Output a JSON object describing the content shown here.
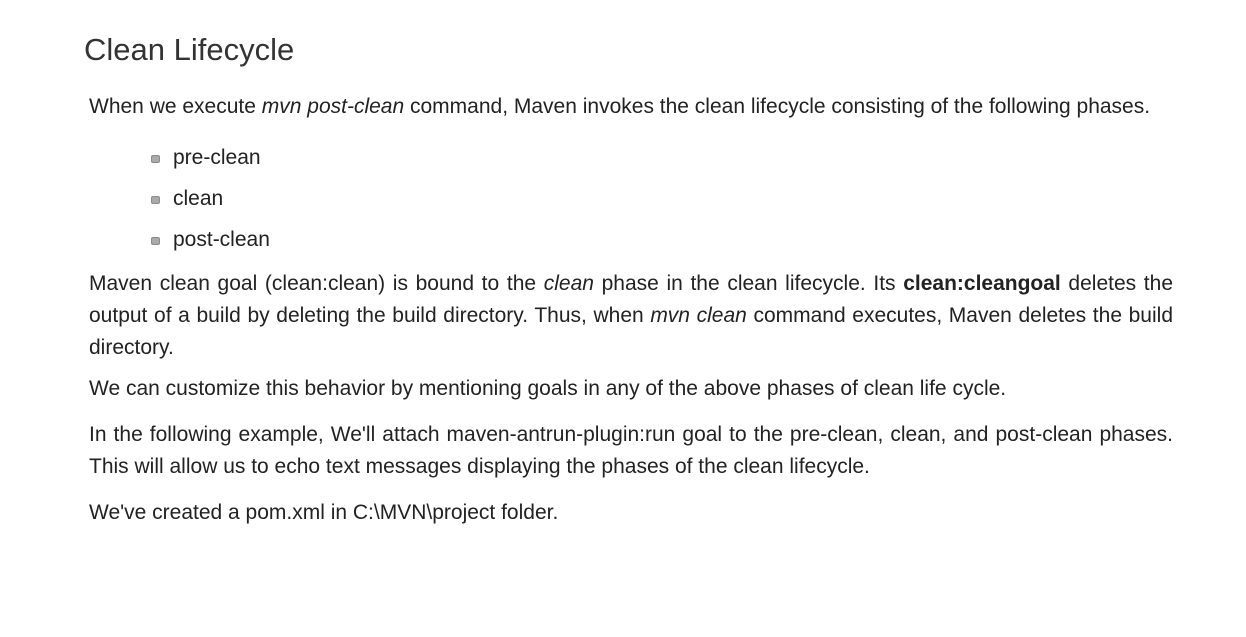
{
  "heading": "Clean Lifecycle",
  "intro": {
    "text_1": "When we execute ",
    "em_1": "mvn post-clean",
    "text_2": " command, Maven invokes the clean lifecycle consisting of the following phases."
  },
  "phases": [
    {
      "label": "pre-clean"
    },
    {
      "label": "clean"
    },
    {
      "label": "post-clean"
    }
  ],
  "goal_paragraph": {
    "text_1": "Maven clean goal (clean:clean) is bound to the ",
    "em_1": "clean",
    "text_2": " phase in the clean lifecycle. Its ",
    "strong_1": "clean:cleangoal",
    "text_3": " deletes the output of a build by deleting the build directory. Thus, when ",
    "em_2": "mvn clean",
    "text_4": " command executes, Maven deletes the build directory."
  },
  "customize_paragraph": "We can customize this behavior by mentioning goals in any of the above phases of clean life cycle.",
  "example_paragraph": "In the following example, We'll attach maven-antrun-plugin:run goal to the pre-clean, clean, and post-clean phases. This will allow us to echo text messages displaying the phases of the clean lifecycle.",
  "pom_paragraph": "We've created a pom.xml in C:\\MVN\\project folder."
}
